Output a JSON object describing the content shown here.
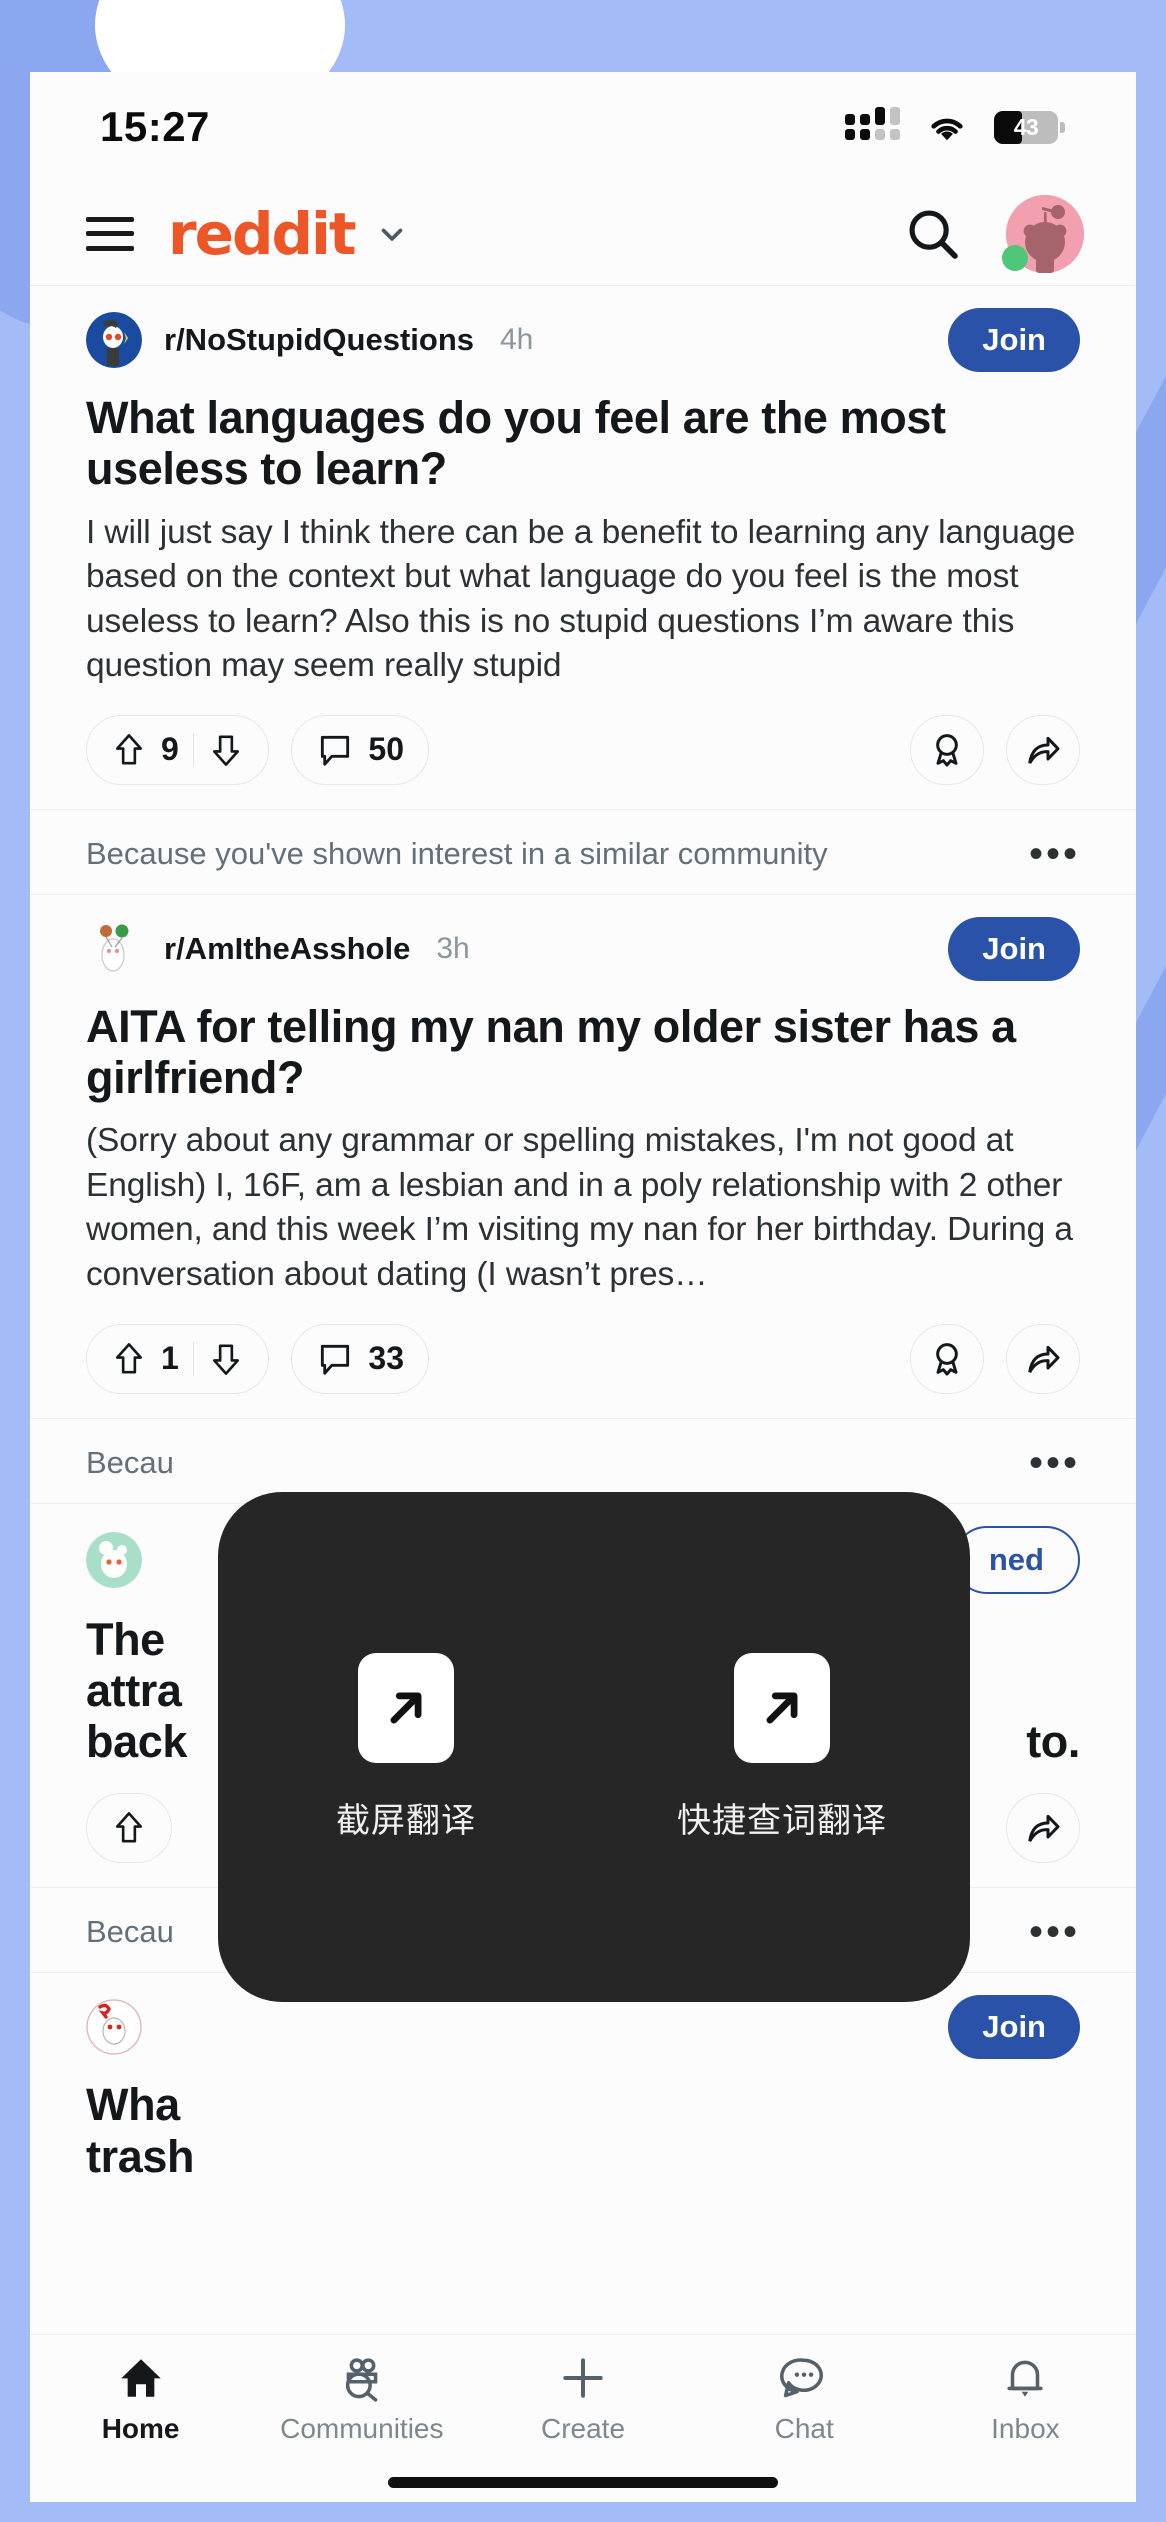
{
  "status_bar": {
    "time": "15:27",
    "battery_level": "43",
    "signal_icon": "cellular-signal-icon",
    "wifi_icon": "wifi-icon",
    "battery_icon": "battery-icon"
  },
  "header": {
    "menu_icon": "hamburger-menu-icon",
    "brand": "reddit",
    "caret_icon": "chevron-down-icon",
    "search_icon": "search-icon",
    "avatar_icon": "user-avatar-snoo"
  },
  "feed": {
    "posts": [
      {
        "subreddit": "r/NoStupidQuestions",
        "age": "4h",
        "join_label": "Join",
        "joined": false,
        "title": "What languages do you feel are the most useless to learn?",
        "body": "I will just say I think there can be a benefit to learning any language based on the context but what language do you feel is the most useless to learn? Also this is no stupid questions I’m aware this question may seem really stupid",
        "upvotes": "9",
        "comments": "50",
        "upvote_icon": "upvote-arrow-icon",
        "downvote_icon": "downvote-arrow-icon",
        "comment_icon": "comment-bubble-icon",
        "award_icon": "award-badge-icon",
        "share_icon": "share-arrow-icon"
      },
      {
        "recommendation": "Because you've shown interest in a similar community",
        "overflow_icon": "more-options-icon",
        "subreddit": "r/AmItheAsshole",
        "age": "3h",
        "join_label": "Join",
        "joined": false,
        "title": "AITA for telling my nan my older sister has a girlfriend?",
        "body": "(Sorry about any grammar or spelling mistakes, I'm not good at English) I, 16F, am a lesbian and in a poly relationship with 2 other women, and this week I’m visiting my nan for her birthday. During a conversation about dating (I wasn’t pres…",
        "upvotes": "1",
        "comments": "33",
        "upvote_icon": "upvote-arrow-icon",
        "downvote_icon": "downvote-arrow-icon",
        "comment_icon": "comment-bubble-icon",
        "award_icon": "award-badge-icon",
        "share_icon": "share-arrow-icon"
      },
      {
        "recommendation": "Becau",
        "overflow_icon": "more-options-icon",
        "subreddit": "",
        "age": "",
        "join_label": "ned",
        "joined": true,
        "title_line1": "The",
        "title_line2": "attra",
        "title_line3": "back",
        "title_line3_tail": "to.",
        "upvote_icon": "upvote-arrow-icon",
        "share_icon": "share-arrow-icon"
      },
      {
        "recommendation": "Becau",
        "overflow_icon": "more-options-icon",
        "join_label": "Join",
        "joined": false,
        "title_line1": "Wha",
        "title_line2": "trash"
      }
    ]
  },
  "translate_popup": {
    "items": [
      {
        "label": "截屏翻译",
        "icon": "arrow-up-right-icon"
      },
      {
        "label": "快捷查词翻译",
        "icon": "arrow-up-right-icon"
      }
    ],
    "background_color": "#262626"
  },
  "bottom_nav": {
    "items": [
      {
        "label": "Home",
        "icon": "home-icon",
        "active": true
      },
      {
        "label": "Communities",
        "icon": "communities-icon",
        "active": false
      },
      {
        "label": "Create",
        "icon": "plus-icon",
        "active": false
      },
      {
        "label": "Chat",
        "icon": "chat-bubble-icon",
        "active": false
      },
      {
        "label": "Inbox",
        "icon": "bell-icon",
        "active": false
      }
    ]
  },
  "colors": {
    "brand_orange": "#ed5627",
    "join_blue": "#2a52a8",
    "wallpaper": "#a3bbf7",
    "popup_dark": "#262626"
  }
}
